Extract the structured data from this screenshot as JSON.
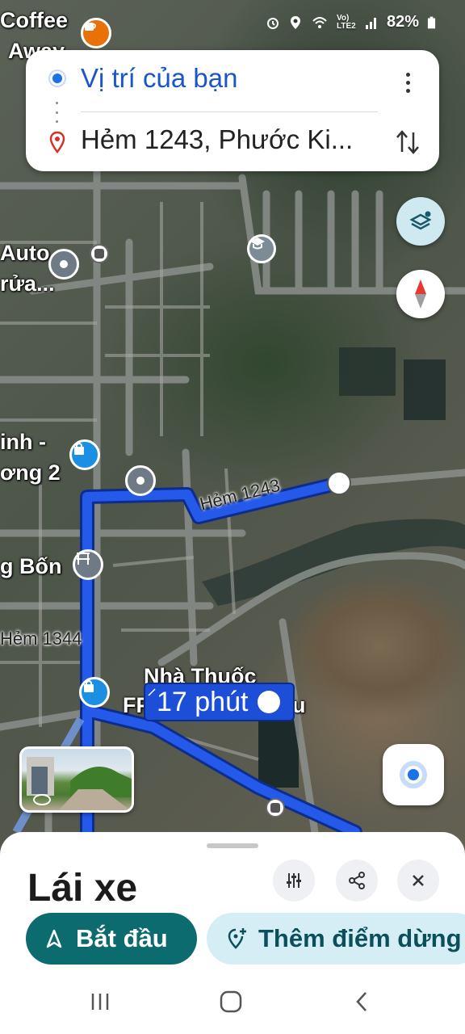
{
  "status_bar": {
    "battery": "82%",
    "network": "Vo) LTE2"
  },
  "route_card": {
    "origin": "Vị trí của bạn",
    "destination": "Hẻm 1243, Phước Ki..."
  },
  "map": {
    "labels": {
      "coffee_line1": "Coffee",
      "coffee_line2": "Away",
      "auto_line1": "Auto",
      "auto_line2": "rửa...",
      "inh_line1": "inh -",
      "inh_line2": "ơng 2",
      "bon": "g Bốn",
      "pharmacy_line1": "Nhà Thuốc",
      "pharmacy_line2": "FP",
      "pharmacy_suffix": "u"
    },
    "streets": {
      "hem_1243": "Hẻm 1243",
      "hem_1344": "Hẻm 1344"
    },
    "eta": "17 phút"
  },
  "sheet": {
    "title": "Lái xe",
    "start_label": "Bắt đầu",
    "add_stop_label": "Thêm điểm dừng"
  },
  "colors": {
    "route": "#1d4ed8",
    "accent_teal": "#0b6b6e",
    "origin_text": "#1a56c8"
  }
}
